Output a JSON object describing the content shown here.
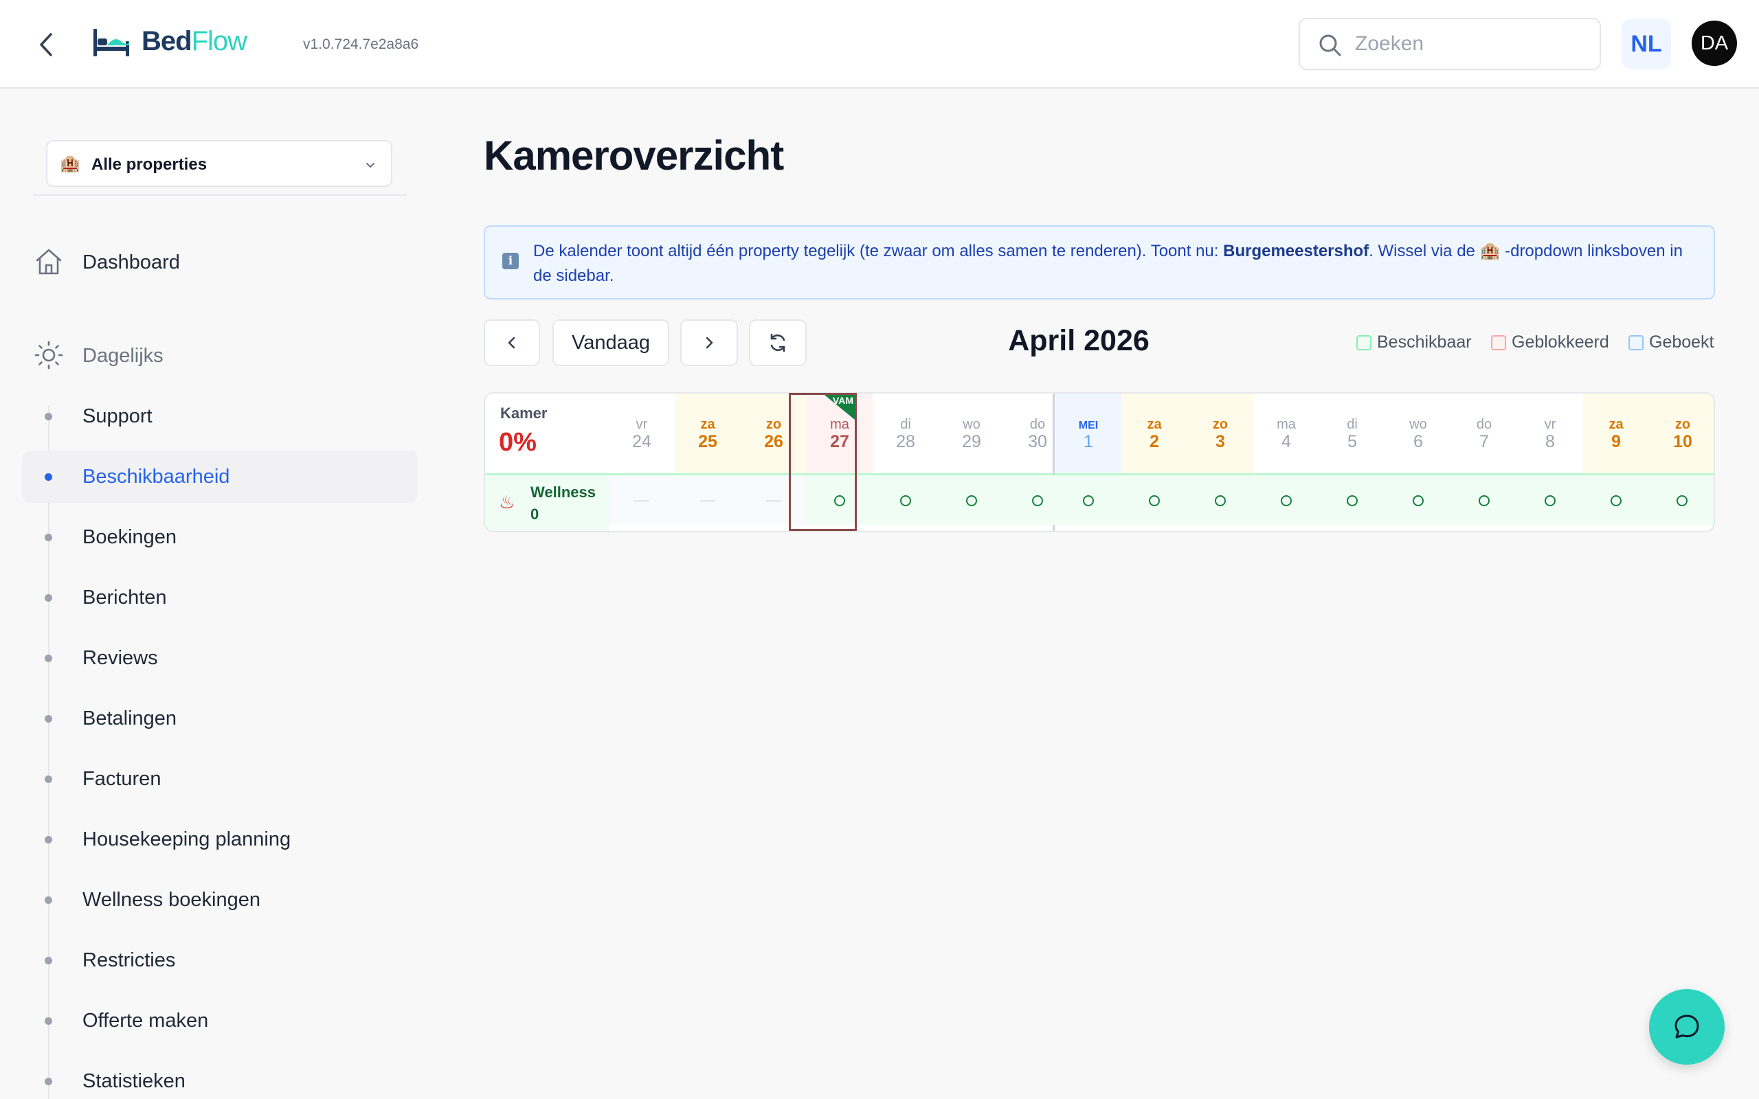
{
  "header": {
    "logo_part1": "Bed",
    "logo_part2": "Flow",
    "version": "v1.0.724.7e2a8a6",
    "search_placeholder": "Zoeken",
    "language": "NL",
    "avatar_initials": "DA"
  },
  "sidebar": {
    "property_select": "Alle properties",
    "dashboard": "Dashboard",
    "daily_group": "Dagelijks",
    "items": [
      {
        "label": "Support"
      },
      {
        "label": "Beschikbaarheid",
        "active": true
      },
      {
        "label": "Boekingen"
      },
      {
        "label": "Berichten"
      },
      {
        "label": "Reviews"
      },
      {
        "label": "Betalingen"
      },
      {
        "label": "Facturen"
      },
      {
        "label": "Housekeeping planning"
      },
      {
        "label": "Wellness boekingen"
      },
      {
        "label": "Restricties"
      },
      {
        "label": "Offerte maken"
      },
      {
        "label": "Statistieken"
      }
    ]
  },
  "main": {
    "title": "Kameroverzicht",
    "info": {
      "text_before": "De kalender toont altijd één property tegelijk (te zwaar om alles samen te renderen). Toont nu: ",
      "property": "Burgemeestershof",
      "text_after": ". Wissel via de 🏨 -dropdown linksboven in de sidebar."
    },
    "today_button": "Vandaag",
    "month_label": "April 2026",
    "legend": [
      {
        "label": "Beschikbaar",
        "color": "#86efac"
      },
      {
        "label": "Geblokkeerd",
        "color": "#fca5a5"
      },
      {
        "label": "Geboekt",
        "color": "#93c5fd"
      }
    ]
  },
  "calendar": {
    "room_header": "Kamer",
    "occupancy": "0%",
    "today_badge": "VAM",
    "days": [
      {
        "dow": "vr",
        "num": "24",
        "kind": "weekday",
        "status": "empty"
      },
      {
        "dow": "za",
        "num": "25",
        "kind": "weekend",
        "status": "empty"
      },
      {
        "dow": "zo",
        "num": "26",
        "kind": "weekend",
        "status": "empty"
      },
      {
        "dow": "ma",
        "num": "27",
        "kind": "today",
        "status": "available"
      },
      {
        "dow": "di",
        "num": "28",
        "kind": "weekday",
        "status": "available"
      },
      {
        "dow": "wo",
        "num": "29",
        "kind": "weekday",
        "status": "available"
      },
      {
        "dow": "do",
        "num": "30",
        "kind": "weekday",
        "status": "available"
      },
      {
        "dow": "MEI",
        "num": "1",
        "kind": "month-start",
        "status": "available"
      },
      {
        "dow": "za",
        "num": "2",
        "kind": "weekend",
        "status": "available"
      },
      {
        "dow": "zo",
        "num": "3",
        "kind": "weekend",
        "status": "available"
      },
      {
        "dow": "ma",
        "num": "4",
        "kind": "weekday",
        "status": "available"
      },
      {
        "dow": "di",
        "num": "5",
        "kind": "weekday",
        "status": "available"
      },
      {
        "dow": "wo",
        "num": "6",
        "kind": "weekday",
        "status": "available"
      },
      {
        "dow": "do",
        "num": "7",
        "kind": "weekday",
        "status": "available"
      },
      {
        "dow": "vr",
        "num": "8",
        "kind": "weekday",
        "status": "available"
      },
      {
        "dow": "za",
        "num": "9",
        "kind": "weekend",
        "status": "available"
      },
      {
        "dow": "zo",
        "num": "10",
        "kind": "weekend",
        "status": "available"
      }
    ],
    "rooms": [
      {
        "icon": "hot-springs-icon",
        "name": "Wellness",
        "count": "0"
      }
    ],
    "empty_mark": "—"
  }
}
